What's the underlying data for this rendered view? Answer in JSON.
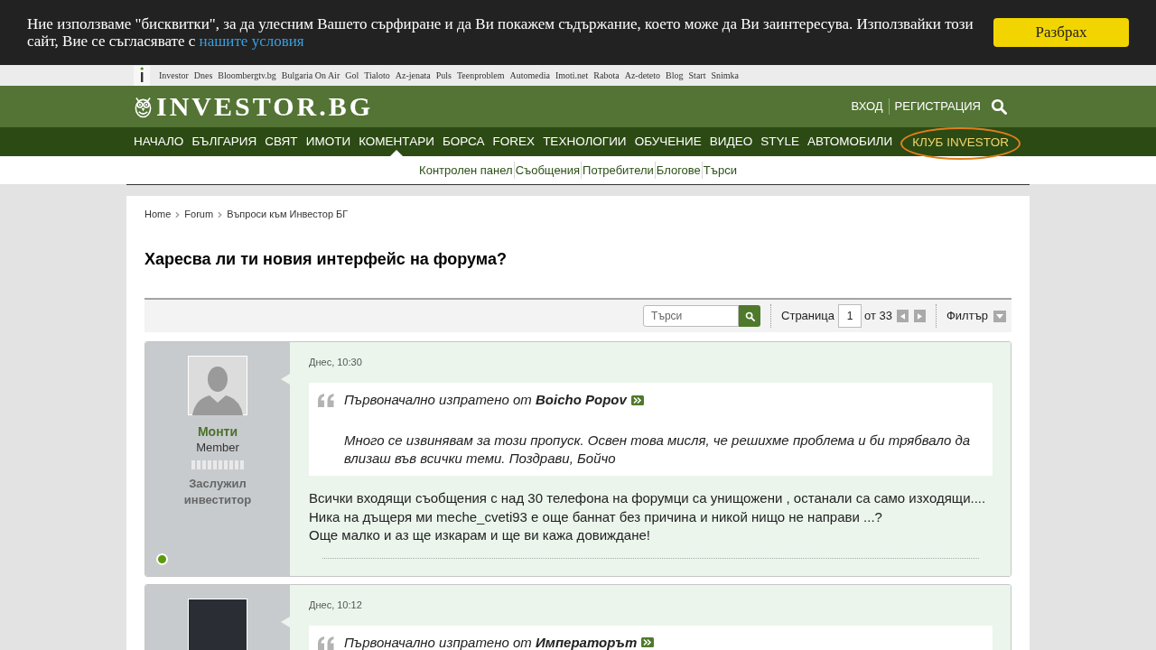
{
  "cookie_bar": {
    "text": "Ние използваме \"бисквитки\", за да улесним Вашето сърфиране и да Ви покажем съдържание, което може да Ви заинтересува. Използвайки този сайт, Вие се съгласявате с",
    "link": "нашите условия",
    "button": "Разбрах"
  },
  "network_bar": {
    "links": [
      "Investor",
      "Dnes",
      "Bloombergtv.bg",
      "Bulgaria On Air",
      "Gol",
      "Tialoto",
      "Az-jenata",
      "Puls",
      "Teenproblem",
      "Automedia",
      "Imoti.net",
      "Rabota",
      "Az-deteto",
      "Blog",
      "Start",
      "Snimka"
    ]
  },
  "header": {
    "logo": "INVESTOR.BG",
    "login": "ВХОД",
    "register": "РЕГИСТРАЦИЯ"
  },
  "nav": [
    {
      "label": "НАЧАЛО",
      "selected": false,
      "kind": "section"
    },
    {
      "label": "БЪЛГАРИЯ",
      "selected": false,
      "kind": "section"
    },
    {
      "label": "СВЯТ",
      "selected": false,
      "kind": "section"
    },
    {
      "label": "ИМОТИ",
      "selected": false,
      "kind": "section"
    },
    {
      "label": "КОМЕНТАРИ",
      "selected": true,
      "kind": "section"
    },
    {
      "label": "БОРСА",
      "selected": false,
      "kind": "section"
    },
    {
      "label": "FOREX",
      "selected": false,
      "kind": "section"
    },
    {
      "label": "ТЕХНОЛОГИИ",
      "selected": false,
      "kind": "section"
    },
    {
      "label": "ОБУЧЕНИЕ",
      "selected": false,
      "kind": "section"
    },
    {
      "label": "ВИДЕО",
      "selected": false,
      "kind": "section"
    },
    {
      "label": "STYLE",
      "selected": false,
      "kind": "section"
    },
    {
      "label": "АВТОМОБИЛИ",
      "selected": false,
      "kind": "section"
    },
    {
      "label": "КЛУБ INVESTOR",
      "selected": false,
      "kind": "club"
    }
  ],
  "subnav": [
    "Контролен панел",
    "Съобщения",
    "Потребители",
    "Блогове",
    "Търси"
  ],
  "breadcrumb": [
    "Home",
    "Forum",
    "Въпроси към Инвестор БГ"
  ],
  "thread_title": "Харесва ли ти новия интерфейс на форума?",
  "toolbar": {
    "search_placeholder": "Търси",
    "page_label": "Страница",
    "page_value": "1",
    "page_total": "от 33",
    "filter": "Филтър"
  },
  "posts": [
    {
      "avatar": {
        "kind": "default"
      },
      "author": "Монти",
      "role": "Member",
      "rank": "Заслужил инвеститор",
      "online": true,
      "time": "Днес, 10:30",
      "quote": {
        "header": "Първоначално изпратено от **Boicho Popov**",
        "text": "Много се извинявам за този пропуск. Освен това мисля, че решихме проблема и би трябвало да влизаш във всички теми. Поздрави, Бойчо"
      },
      "body": [
        "Всички входящи съобщения с над 30 телефона на форумци са унищожени , останали са само изходящи....",
        "Ника на дъщеря ми meche_cveti93 е още баннат без причина и никой нищо не направи ...?",
        "Още малко и аз ще изкарам и ще ви кажа довиждане!"
      ]
    },
    {
      "avatar": {
        "kind": "photo"
      },
      "time": "Днес, 10:12",
      "quote": {
        "header": "Първоначално изпратено от **Императорът**"
      }
    }
  ]
}
